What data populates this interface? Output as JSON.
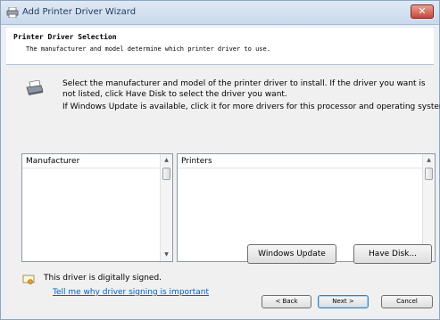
{
  "window": {
    "title": "Add Printer Driver Wizard",
    "close_symbol": "✕"
  },
  "header": {
    "title": "Printer Driver Selection",
    "subtitle": "The manufacturer and model determine which printer driver to use."
  },
  "body": {
    "instruction": "Select the manufacturer and model of the printer driver to install. If the driver you want is not listed, click Have Disk to select the driver you want.",
    "windows_update_note": "If Windows Update is available, click it for more drivers for this processor and operating system."
  },
  "manufacturer_list": {
    "header": "Manufacturer",
    "items": []
  },
  "printers_list": {
    "header": "Printers",
    "items": []
  },
  "signing": {
    "status": "This driver is digitally signed.",
    "link": "Tell me why driver signing is important"
  },
  "buttons": {
    "windows_update": "Windows Update",
    "have_disk": "Have Disk...",
    "back": "< Back",
    "next": "Next >",
    "cancel": "Cancel"
  },
  "icons": {
    "title": "printer-icon",
    "body": "printer-icon",
    "signed": "certificate-icon",
    "scroll_up": "triangle-up",
    "scroll_down": "triangle-down"
  }
}
